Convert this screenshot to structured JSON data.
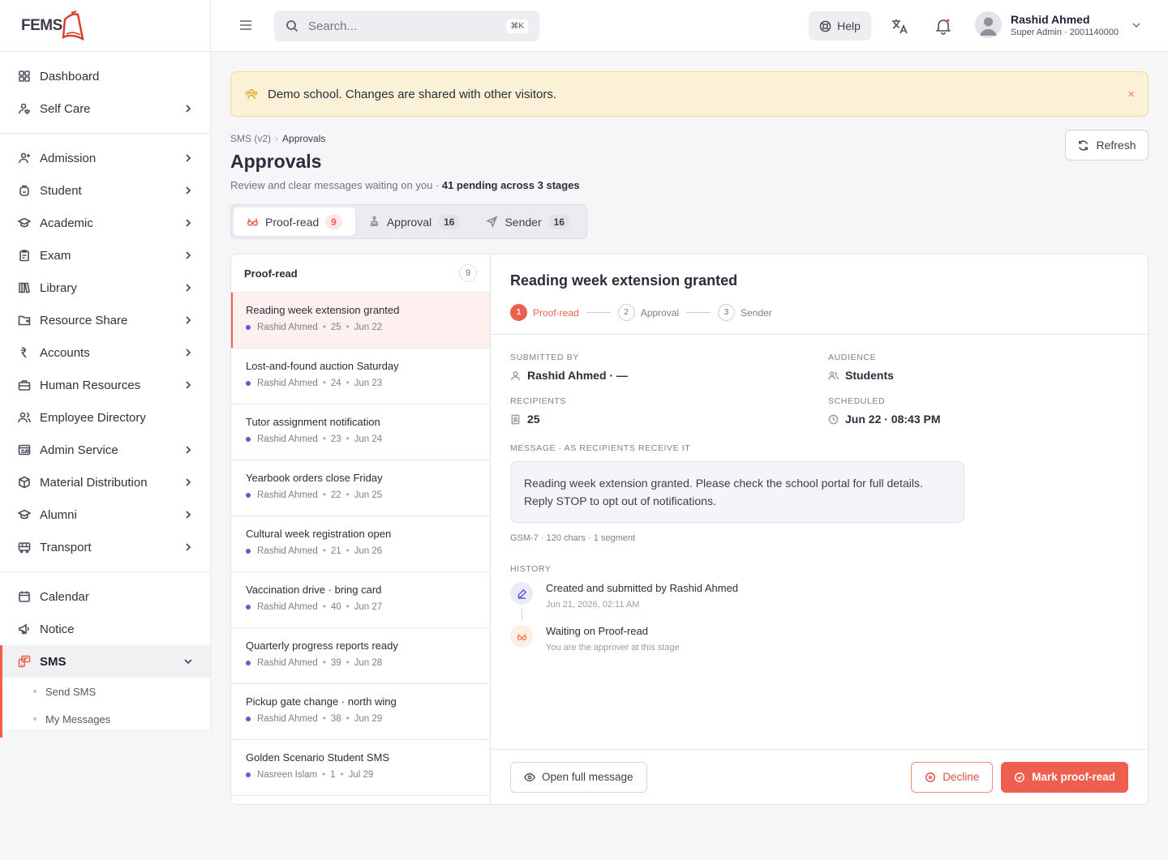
{
  "brand": {
    "logo": "FEMS"
  },
  "sidebar": {
    "group1": [
      {
        "label": "Dashboard",
        "icon": "grid-icon"
      },
      {
        "label": "Self Care",
        "icon": "user-heart-icon"
      }
    ],
    "group2": [
      {
        "label": "Admission",
        "icon": "user-plus-icon"
      },
      {
        "label": "Student",
        "icon": "backpack-icon"
      },
      {
        "label": "Academic",
        "icon": "graduation-cap-icon"
      },
      {
        "label": "Exam",
        "icon": "clipboard-icon"
      },
      {
        "label": "Library",
        "icon": "books-icon"
      },
      {
        "label": "Resource Share",
        "icon": "folder-share-icon"
      },
      {
        "label": "Accounts",
        "icon": "currency-icon"
      },
      {
        "label": "Human Resources",
        "icon": "briefcase-icon"
      },
      {
        "label": "Employee Directory",
        "icon": "users-icon"
      },
      {
        "label": "Admin Service",
        "icon": "admin-icon"
      },
      {
        "label": "Material Distribution",
        "icon": "box-icon"
      },
      {
        "label": "Alumni",
        "icon": "graduation-cap-icon"
      },
      {
        "label": "Transport",
        "icon": "bus-icon"
      }
    ],
    "group3": [
      {
        "label": "Calendar",
        "icon": "calendar-icon"
      },
      {
        "label": "Notice",
        "icon": "megaphone-icon"
      },
      {
        "label": "SMS",
        "icon": "sms-icon"
      }
    ],
    "sms_sub": [
      {
        "label": "Send SMS"
      },
      {
        "label": "My Messages"
      }
    ]
  },
  "topbar": {
    "search_placeholder": "Search...",
    "kbd": "⌘K",
    "help": "Help",
    "user_name": "Rashid Ahmed",
    "user_role": "Super Admin · 2001140000"
  },
  "banner": {
    "text": "Demo school. Changes are shared with other visitors.",
    "close": "×"
  },
  "breadcrumb": {
    "parent": "SMS (v2)",
    "sep": "›",
    "current": "Approvals"
  },
  "page": {
    "title": "Approvals",
    "subtitle": "Review and clear messages waiting on you · ",
    "subtitle_bold": "41 pending across 3 stages",
    "refresh": "Refresh"
  },
  "tabs": [
    {
      "label": "Proof-read",
      "count": "9"
    },
    {
      "label": "Approval",
      "count": "16"
    },
    {
      "label": "Sender",
      "count": "16"
    }
  ],
  "list": {
    "title": "Proof-read",
    "count": "9",
    "items": [
      {
        "title": "Reading week extension granted",
        "author": "Rashid Ahmed",
        "recipients": "25",
        "date": "Jun 22"
      },
      {
        "title": "Lost-and-found auction Saturday",
        "author": "Rashid Ahmed",
        "recipients": "24",
        "date": "Jun 23"
      },
      {
        "title": "Tutor assignment notification",
        "author": "Rashid Ahmed",
        "recipients": "23",
        "date": "Jun 24"
      },
      {
        "title": "Yearbook orders close Friday",
        "author": "Rashid Ahmed",
        "recipients": "22",
        "date": "Jun 25"
      },
      {
        "title": "Cultural week registration open",
        "author": "Rashid Ahmed",
        "recipients": "21",
        "date": "Jun 26"
      },
      {
        "title": "Vaccination drive · bring card",
        "author": "Rashid Ahmed",
        "recipients": "40",
        "date": "Jun 27"
      },
      {
        "title": "Quarterly progress reports ready",
        "author": "Rashid Ahmed",
        "recipients": "39",
        "date": "Jun 28"
      },
      {
        "title": "Pickup gate change · north wing",
        "author": "Rashid Ahmed",
        "recipients": "38",
        "date": "Jun 29"
      },
      {
        "title": "Golden Scenario Student SMS",
        "author": "Nasreen Islam",
        "recipients": "1",
        "date": "Jul 29"
      }
    ]
  },
  "detail": {
    "title": "Reading week extension granted",
    "steps": [
      {
        "n": "1",
        "label": "Proof-read"
      },
      {
        "n": "2",
        "label": "Approval"
      },
      {
        "n": "3",
        "label": "Sender"
      }
    ],
    "submitted_by_label": "SUBMITTED BY",
    "submitted_by": "Rashid Ahmed · —",
    "audience_label": "AUDIENCE",
    "audience": "Students",
    "recipients_label": "RECIPIENTS",
    "recipients": "25",
    "scheduled_label": "SCHEDULED",
    "scheduled": "Jun 22 · 08:43 PM",
    "message_label": "MESSAGE · AS RECIPIENTS RECEIVE IT",
    "message": "Reading week extension granted. Please check the school portal for full details. Reply STOP to opt out of notifications.",
    "meta": "GSM-7  ·  120 chars  ·  1 segment",
    "history_label": "HISTORY",
    "history": [
      {
        "title": "Created and submitted by Rashid Ahmed",
        "sub": "Jun 21, 2026, 02:11 AM"
      },
      {
        "title": "Waiting on Proof-read",
        "sub": "You are the approver at this stage"
      }
    ],
    "open_full": "Open full message",
    "decline": "Decline",
    "mark": "Mark proof-read"
  },
  "colors": {
    "accent": "#ee5f4f",
    "banner_bg": "#fbf1d6",
    "dot": "#5b5bd6"
  }
}
